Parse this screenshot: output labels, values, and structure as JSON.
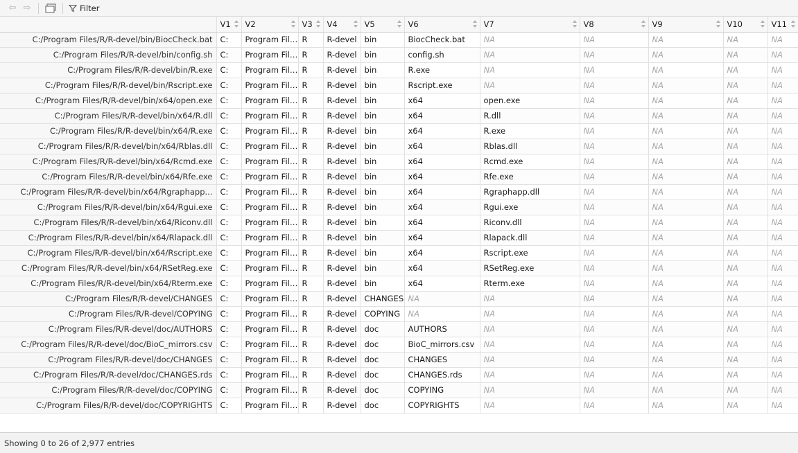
{
  "toolbar": {
    "back_icon": "arrow-left-icon",
    "forward_icon": "arrow-right-icon",
    "popout_icon": "popout-window-icon",
    "filter_label": "Filter"
  },
  "table": {
    "columns": [
      "",
      "V1",
      "V2",
      "V3",
      "V4",
      "V5",
      "V6",
      "V7",
      "V8",
      "V9",
      "V10",
      "V11"
    ],
    "na_label": "NA",
    "rows": [
      [
        "C:/Program Files/R/R-devel/bin/BiocCheck.bat",
        "C:",
        "Program Files",
        "R",
        "R-devel",
        "bin",
        "BiocCheck.bat",
        "NA",
        "NA",
        "NA",
        "NA",
        "NA"
      ],
      [
        "C:/Program Files/R/R-devel/bin/config.sh",
        "C:",
        "Program Files",
        "R",
        "R-devel",
        "bin",
        "config.sh",
        "NA",
        "NA",
        "NA",
        "NA",
        "NA"
      ],
      [
        "C:/Program Files/R/R-devel/bin/R.exe",
        "C:",
        "Program Files",
        "R",
        "R-devel",
        "bin",
        "R.exe",
        "NA",
        "NA",
        "NA",
        "NA",
        "NA"
      ],
      [
        "C:/Program Files/R/R-devel/bin/Rscript.exe",
        "C:",
        "Program Files",
        "R",
        "R-devel",
        "bin",
        "Rscript.exe",
        "NA",
        "NA",
        "NA",
        "NA",
        "NA"
      ],
      [
        "C:/Program Files/R/R-devel/bin/x64/open.exe",
        "C:",
        "Program Files",
        "R",
        "R-devel",
        "bin",
        "x64",
        "open.exe",
        "NA",
        "NA",
        "NA",
        "NA"
      ],
      [
        "C:/Program Files/R/R-devel/bin/x64/R.dll",
        "C:",
        "Program Files",
        "R",
        "R-devel",
        "bin",
        "x64",
        "R.dll",
        "NA",
        "NA",
        "NA",
        "NA"
      ],
      [
        "C:/Program Files/R/R-devel/bin/x64/R.exe",
        "C:",
        "Program Files",
        "R",
        "R-devel",
        "bin",
        "x64",
        "R.exe",
        "NA",
        "NA",
        "NA",
        "NA"
      ],
      [
        "C:/Program Files/R/R-devel/bin/x64/Rblas.dll",
        "C:",
        "Program Files",
        "R",
        "R-devel",
        "bin",
        "x64",
        "Rblas.dll",
        "NA",
        "NA",
        "NA",
        "NA"
      ],
      [
        "C:/Program Files/R/R-devel/bin/x64/Rcmd.exe",
        "C:",
        "Program Files",
        "R",
        "R-devel",
        "bin",
        "x64",
        "Rcmd.exe",
        "NA",
        "NA",
        "NA",
        "NA"
      ],
      [
        "C:/Program Files/R/R-devel/bin/x64/Rfe.exe",
        "C:",
        "Program Files",
        "R",
        "R-devel",
        "bin",
        "x64",
        "Rfe.exe",
        "NA",
        "NA",
        "NA",
        "NA"
      ],
      [
        "C:/Program Files/R/R-devel/bin/x64/Rgraphapp...",
        "C:",
        "Program Files",
        "R",
        "R-devel",
        "bin",
        "x64",
        "Rgraphapp.dll",
        "NA",
        "NA",
        "NA",
        "NA"
      ],
      [
        "C:/Program Files/R/R-devel/bin/x64/Rgui.exe",
        "C:",
        "Program Files",
        "R",
        "R-devel",
        "bin",
        "x64",
        "Rgui.exe",
        "NA",
        "NA",
        "NA",
        "NA"
      ],
      [
        "C:/Program Files/R/R-devel/bin/x64/Riconv.dll",
        "C:",
        "Program Files",
        "R",
        "R-devel",
        "bin",
        "x64",
        "Riconv.dll",
        "NA",
        "NA",
        "NA",
        "NA"
      ],
      [
        "C:/Program Files/R/R-devel/bin/x64/Rlapack.dll",
        "C:",
        "Program Files",
        "R",
        "R-devel",
        "bin",
        "x64",
        "Rlapack.dll",
        "NA",
        "NA",
        "NA",
        "NA"
      ],
      [
        "C:/Program Files/R/R-devel/bin/x64/Rscript.exe",
        "C:",
        "Program Files",
        "R",
        "R-devel",
        "bin",
        "x64",
        "Rscript.exe",
        "NA",
        "NA",
        "NA",
        "NA"
      ],
      [
        "C:/Program Files/R/R-devel/bin/x64/RSetReg.exe",
        "C:",
        "Program Files",
        "R",
        "R-devel",
        "bin",
        "x64",
        "RSetReg.exe",
        "NA",
        "NA",
        "NA",
        "NA"
      ],
      [
        "C:/Program Files/R/R-devel/bin/x64/Rterm.exe",
        "C:",
        "Program Files",
        "R",
        "R-devel",
        "bin",
        "x64",
        "Rterm.exe",
        "NA",
        "NA",
        "NA",
        "NA"
      ],
      [
        "C:/Program Files/R/R-devel/CHANGES",
        "C:",
        "Program Files",
        "R",
        "R-devel",
        "CHANGES",
        "NA",
        "NA",
        "NA",
        "NA",
        "NA",
        "NA"
      ],
      [
        "C:/Program Files/R/R-devel/COPYING",
        "C:",
        "Program Files",
        "R",
        "R-devel",
        "COPYING",
        "NA",
        "NA",
        "NA",
        "NA",
        "NA",
        "NA"
      ],
      [
        "C:/Program Files/R/R-devel/doc/AUTHORS",
        "C:",
        "Program Files",
        "R",
        "R-devel",
        "doc",
        "AUTHORS",
        "NA",
        "NA",
        "NA",
        "NA",
        "NA"
      ],
      [
        "C:/Program Files/R/R-devel/doc/BioC_mirrors.csv",
        "C:",
        "Program Files",
        "R",
        "R-devel",
        "doc",
        "BioC_mirrors.csv",
        "NA",
        "NA",
        "NA",
        "NA",
        "NA"
      ],
      [
        "C:/Program Files/R/R-devel/doc/CHANGES",
        "C:",
        "Program Files",
        "R",
        "R-devel",
        "doc",
        "CHANGES",
        "NA",
        "NA",
        "NA",
        "NA",
        "NA"
      ],
      [
        "C:/Program Files/R/R-devel/doc/CHANGES.rds",
        "C:",
        "Program Files",
        "R",
        "R-devel",
        "doc",
        "CHANGES.rds",
        "NA",
        "NA",
        "NA",
        "NA",
        "NA"
      ],
      [
        "C:/Program Files/R/R-devel/doc/COPYING",
        "C:",
        "Program Files",
        "R",
        "R-devel",
        "doc",
        "COPYING",
        "NA",
        "NA",
        "NA",
        "NA",
        "NA"
      ],
      [
        "C:/Program Files/R/R-devel/doc/COPYRIGHTS",
        "C:",
        "Program Files",
        "R",
        "R-devel",
        "doc",
        "COPYRIGHTS",
        "NA",
        "NA",
        "NA",
        "NA",
        "NA"
      ]
    ]
  },
  "status": {
    "text": "Showing 0 to 26 of 2,977 entries"
  }
}
